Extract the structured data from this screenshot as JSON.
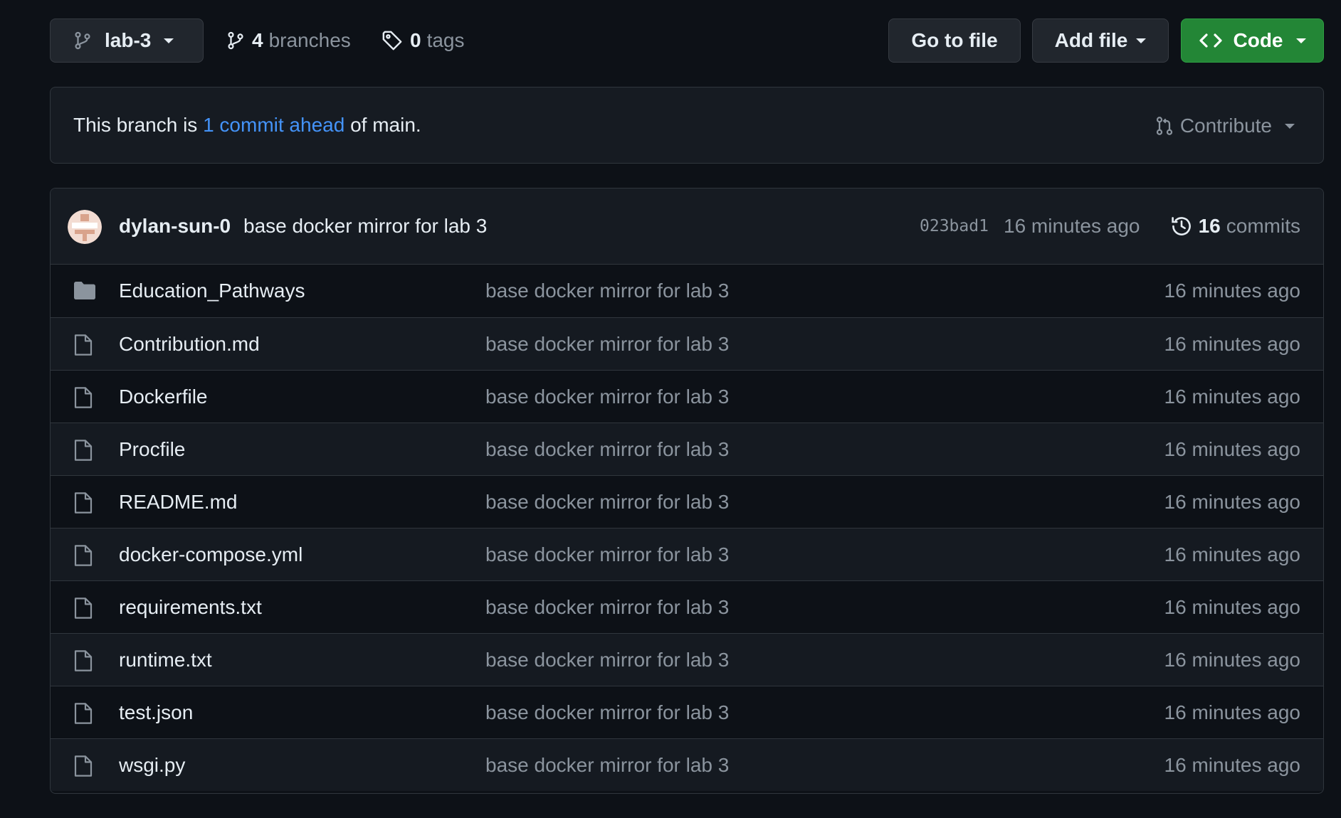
{
  "toolbar": {
    "branch": "lab-3",
    "branches_count": "4",
    "branches_label": "branches",
    "tags_count": "0",
    "tags_label": "tags",
    "go_to_file": "Go to file",
    "add_file": "Add file",
    "code": "Code"
  },
  "ahead": {
    "prefix": "This branch is",
    "link": "1 commit ahead",
    "suffix": "of main.",
    "contribute": "Contribute"
  },
  "latest_commit": {
    "author": "dylan-sun-0",
    "message": "base docker mirror for lab 3",
    "sha": "023bad1",
    "time": "16 minutes ago",
    "commits_count": "16",
    "commits_label": "commits"
  },
  "files": [
    {
      "name": "Education_Pathways",
      "type": "folder",
      "message": "base docker mirror for lab 3",
      "time": "16 minutes ago"
    },
    {
      "name": "Contribution.md",
      "type": "file",
      "message": "base docker mirror for lab 3",
      "time": "16 minutes ago"
    },
    {
      "name": "Dockerfile",
      "type": "file",
      "message": "base docker mirror for lab 3",
      "time": "16 minutes ago"
    },
    {
      "name": "Procfile",
      "type": "file",
      "message": "base docker mirror for lab 3",
      "time": "16 minutes ago"
    },
    {
      "name": "README.md",
      "type": "file",
      "message": "base docker mirror for lab 3",
      "time": "16 minutes ago"
    },
    {
      "name": "docker-compose.yml",
      "type": "file",
      "message": "base docker mirror for lab 3",
      "time": "16 minutes ago"
    },
    {
      "name": "requirements.txt",
      "type": "file",
      "message": "base docker mirror for lab 3",
      "time": "16 minutes ago"
    },
    {
      "name": "runtime.txt",
      "type": "file",
      "message": "base docker mirror for lab 3",
      "time": "16 minutes ago"
    },
    {
      "name": "test.json",
      "type": "file",
      "message": "base docker mirror for lab 3",
      "time": "16 minutes ago"
    },
    {
      "name": "wsgi.py",
      "type": "file",
      "message": "base docker mirror for lab 3",
      "time": "16 minutes ago"
    }
  ],
  "colors": {
    "background": "#0d1117",
    "accent_link": "#4493f8",
    "code_button": "#238636",
    "muted_text": "#8b949e"
  },
  "icons": {
    "branch": "git-branch-icon",
    "tag": "tag-icon",
    "code": "code-icon",
    "contribute": "git-pull-request-icon",
    "history": "history-icon",
    "folder": "folder-icon",
    "file": "file-icon"
  }
}
